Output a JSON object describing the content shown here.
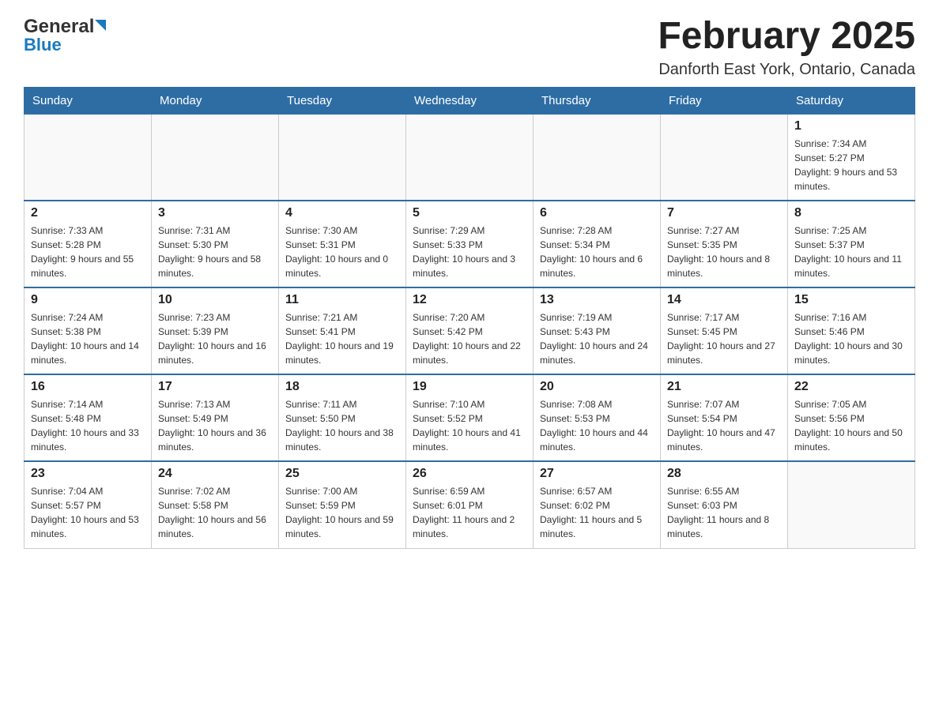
{
  "header": {
    "logo_general": "General",
    "logo_blue": "Blue",
    "month_title": "February 2025",
    "location": "Danforth East York, Ontario, Canada"
  },
  "weekdays": [
    "Sunday",
    "Monday",
    "Tuesday",
    "Wednesday",
    "Thursday",
    "Friday",
    "Saturday"
  ],
  "weeks": [
    [
      {
        "day": "",
        "info": ""
      },
      {
        "day": "",
        "info": ""
      },
      {
        "day": "",
        "info": ""
      },
      {
        "day": "",
        "info": ""
      },
      {
        "day": "",
        "info": ""
      },
      {
        "day": "",
        "info": ""
      },
      {
        "day": "1",
        "info": "Sunrise: 7:34 AM\nSunset: 5:27 PM\nDaylight: 9 hours and 53 minutes."
      }
    ],
    [
      {
        "day": "2",
        "info": "Sunrise: 7:33 AM\nSunset: 5:28 PM\nDaylight: 9 hours and 55 minutes."
      },
      {
        "day": "3",
        "info": "Sunrise: 7:31 AM\nSunset: 5:30 PM\nDaylight: 9 hours and 58 minutes."
      },
      {
        "day": "4",
        "info": "Sunrise: 7:30 AM\nSunset: 5:31 PM\nDaylight: 10 hours and 0 minutes."
      },
      {
        "day": "5",
        "info": "Sunrise: 7:29 AM\nSunset: 5:33 PM\nDaylight: 10 hours and 3 minutes."
      },
      {
        "day": "6",
        "info": "Sunrise: 7:28 AM\nSunset: 5:34 PM\nDaylight: 10 hours and 6 minutes."
      },
      {
        "day": "7",
        "info": "Sunrise: 7:27 AM\nSunset: 5:35 PM\nDaylight: 10 hours and 8 minutes."
      },
      {
        "day": "8",
        "info": "Sunrise: 7:25 AM\nSunset: 5:37 PM\nDaylight: 10 hours and 11 minutes."
      }
    ],
    [
      {
        "day": "9",
        "info": "Sunrise: 7:24 AM\nSunset: 5:38 PM\nDaylight: 10 hours and 14 minutes."
      },
      {
        "day": "10",
        "info": "Sunrise: 7:23 AM\nSunset: 5:39 PM\nDaylight: 10 hours and 16 minutes."
      },
      {
        "day": "11",
        "info": "Sunrise: 7:21 AM\nSunset: 5:41 PM\nDaylight: 10 hours and 19 minutes."
      },
      {
        "day": "12",
        "info": "Sunrise: 7:20 AM\nSunset: 5:42 PM\nDaylight: 10 hours and 22 minutes."
      },
      {
        "day": "13",
        "info": "Sunrise: 7:19 AM\nSunset: 5:43 PM\nDaylight: 10 hours and 24 minutes."
      },
      {
        "day": "14",
        "info": "Sunrise: 7:17 AM\nSunset: 5:45 PM\nDaylight: 10 hours and 27 minutes."
      },
      {
        "day": "15",
        "info": "Sunrise: 7:16 AM\nSunset: 5:46 PM\nDaylight: 10 hours and 30 minutes."
      }
    ],
    [
      {
        "day": "16",
        "info": "Sunrise: 7:14 AM\nSunset: 5:48 PM\nDaylight: 10 hours and 33 minutes."
      },
      {
        "day": "17",
        "info": "Sunrise: 7:13 AM\nSunset: 5:49 PM\nDaylight: 10 hours and 36 minutes."
      },
      {
        "day": "18",
        "info": "Sunrise: 7:11 AM\nSunset: 5:50 PM\nDaylight: 10 hours and 38 minutes."
      },
      {
        "day": "19",
        "info": "Sunrise: 7:10 AM\nSunset: 5:52 PM\nDaylight: 10 hours and 41 minutes."
      },
      {
        "day": "20",
        "info": "Sunrise: 7:08 AM\nSunset: 5:53 PM\nDaylight: 10 hours and 44 minutes."
      },
      {
        "day": "21",
        "info": "Sunrise: 7:07 AM\nSunset: 5:54 PM\nDaylight: 10 hours and 47 minutes."
      },
      {
        "day": "22",
        "info": "Sunrise: 7:05 AM\nSunset: 5:56 PM\nDaylight: 10 hours and 50 minutes."
      }
    ],
    [
      {
        "day": "23",
        "info": "Sunrise: 7:04 AM\nSunset: 5:57 PM\nDaylight: 10 hours and 53 minutes."
      },
      {
        "day": "24",
        "info": "Sunrise: 7:02 AM\nSunset: 5:58 PM\nDaylight: 10 hours and 56 minutes."
      },
      {
        "day": "25",
        "info": "Sunrise: 7:00 AM\nSunset: 5:59 PM\nDaylight: 10 hours and 59 minutes."
      },
      {
        "day": "26",
        "info": "Sunrise: 6:59 AM\nSunset: 6:01 PM\nDaylight: 11 hours and 2 minutes."
      },
      {
        "day": "27",
        "info": "Sunrise: 6:57 AM\nSunset: 6:02 PM\nDaylight: 11 hours and 5 minutes."
      },
      {
        "day": "28",
        "info": "Sunrise: 6:55 AM\nSunset: 6:03 PM\nDaylight: 11 hours and 8 minutes."
      },
      {
        "day": "",
        "info": ""
      }
    ]
  ]
}
